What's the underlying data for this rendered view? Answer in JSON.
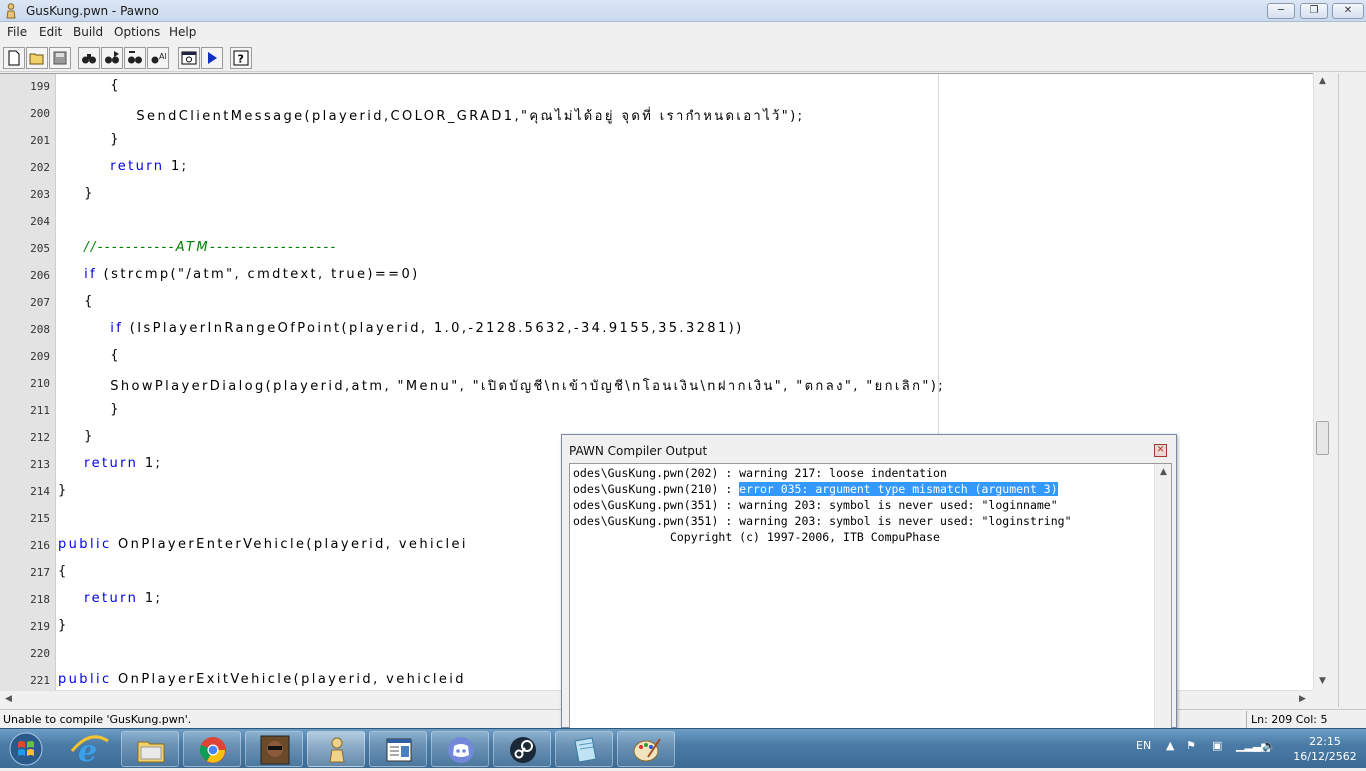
{
  "window": {
    "title": "GusKung.pwn - Pawno"
  },
  "menu": {
    "file": "File",
    "edit": "Edit",
    "build": "Build",
    "options": "Options",
    "help": "Help"
  },
  "editor": {
    "lines": [
      {
        "n": "199",
        "t": "        {"
      },
      {
        "n": "200",
        "t": "            SendClientMessage(playerid,COLOR_GRAD1,\"คุณไม่ได้อยู่ จุดที่ เรากำหนดเอาไว้\");"
      },
      {
        "n": "201",
        "t": "        }"
      },
      {
        "n": "202",
        "t": "        return 1;"
      },
      {
        "n": "203",
        "t": "    }"
      },
      {
        "n": "204",
        "t": ""
      },
      {
        "n": "205",
        "t": "    //-----------ATM------------------"
      },
      {
        "n": "206",
        "t": "    if (strcmp(\"/atm\", cmdtext, true)==0)"
      },
      {
        "n": "207",
        "t": "    {"
      },
      {
        "n": "208",
        "t": "        if (IsPlayerInRangeOfPoint(playerid, 1.0,-2128.5632,-34.9155,35.3281))"
      },
      {
        "n": "209",
        "t": "        {"
      },
      {
        "n": "210",
        "t": "        ShowPlayerDialog(playerid,atm, \"Menu\", \"เปิดบัญชี\\nเข้าบัญชี\\nโอนเงิน\\nฝากเงิน\", \"ตกลง\", \"ยกเลิก\");"
      },
      {
        "n": "211",
        "t": "        }"
      },
      {
        "n": "212",
        "t": "    }"
      },
      {
        "n": "213",
        "t": "    return 1;"
      },
      {
        "n": "214",
        "t": "}"
      },
      {
        "n": "215",
        "t": ""
      },
      {
        "n": "216",
        "t": "public OnPlayerEnterVehicle(playerid, vehiclei"
      },
      {
        "n": "217",
        "t": "{"
      },
      {
        "n": "218",
        "t": "    return 1;"
      },
      {
        "n": "219",
        "t": "}"
      },
      {
        "n": "220",
        "t": ""
      },
      {
        "n": "221",
        "t": "public OnPlayerExitVehicle(playerid, vehicleid"
      }
    ]
  },
  "compiler": {
    "title": "PAWN Compiler Output",
    "lines": [
      {
        "pre": "odes\\GusKung.pwn(202) : ",
        "msg": "warning 217: loose indentation",
        "selected": false
      },
      {
        "pre": "odes\\GusKung.pwn(210) : ",
        "msg": "error 035: argument type mismatch (argument 3)",
        "selected": true
      },
      {
        "pre": "odes\\GusKung.pwn(351) : ",
        "msg": "warning 203: symbol is never used: \"loginname\"",
        "selected": false
      },
      {
        "pre": "odes\\GusKung.pwn(351) : ",
        "msg": "warning 203: symbol is never used: \"loginstring\"",
        "selected": false
      },
      {
        "pre": "              ",
        "msg": "Copyright (c) 1997-2006, ITB CompuPhase",
        "selected": false
      }
    ]
  },
  "status": {
    "message": "Unable to compile 'GusKung.pwn'.",
    "position": "Ln: 209   Col: 5"
  },
  "taskbar": {
    "language": "EN",
    "time": "22:15",
    "date": "16/12/2562",
    "apps": [
      "internet-explorer",
      "file-explorer",
      "chrome",
      "gta-sa",
      "pawno",
      "notepad",
      "discord",
      "steam",
      "notepad-blue",
      "paint"
    ]
  }
}
